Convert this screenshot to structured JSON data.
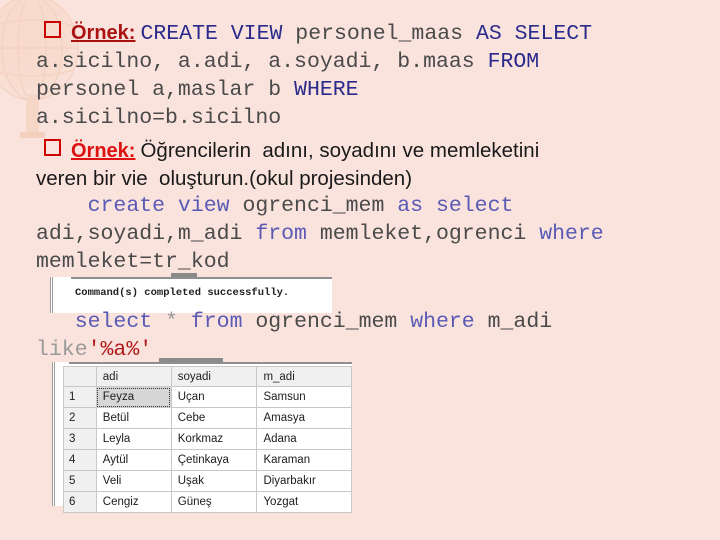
{
  "slide": {
    "background_color": "#fae3dd",
    "watermark": "globe-watermark"
  },
  "block1": {
    "bullet": "square-bullet",
    "label": "Örnek:",
    "label_color": "#aa1111",
    "lines": [
      {
        "parts": [
          {
            "t": "CREATE VIEW ",
            "c": "kw"
          },
          {
            "t": "personel_maas ",
            "c": "ident"
          },
          {
            "t": "AS SELECT",
            "c": "kw"
          }
        ]
      },
      {
        "parts": [
          {
            "t": "a.sicilno, a.adi, a.soyadi, b.maas ",
            "c": "ident"
          },
          {
            "t": "FROM",
            "c": "kw"
          }
        ]
      },
      {
        "parts": [
          {
            "t": "personel a,maslar b ",
            "c": "ident"
          },
          {
            "t": "WHERE",
            "c": "kw"
          }
        ]
      },
      {
        "parts": [
          {
            "t": "a.sicilno=b.sicilno",
            "c": "ident"
          }
        ]
      }
    ],
    "line1_text": "CREATE VIEW personel_maas AS SELECT",
    "line2_text": "a.sicilno, a.adi, a.soyadi, b.maas FROM",
    "line3_text": "personel a,maslar b WHERE",
    "line4_text": "a.sicilno=b.sicilno"
  },
  "block2": {
    "bullet": "square-bullet",
    "label": "Örnek:",
    "label_color": "#dd1111",
    "prompt_line1": "Öğrencilerin  adını, soyadını ve memleketini",
    "prompt_line2": "veren bir vie  oluşturun.(okul projesinden)",
    "sql_line1_a": "create view ",
    "sql_line1_b": "ogrenci_mem ",
    "sql_line1_c": "as select",
    "sql_line2_a": "adi,soyadi,m_adi ",
    "sql_line2_b": "from ",
    "sql_line2_c": "memleket,ogrenci ",
    "sql_line2_d": "where",
    "sql_line3": "memleket=tr_kod"
  },
  "message_box": {
    "text": "Command(s) completed successfully."
  },
  "query2": {
    "a": "select ",
    "b": "* ",
    "c": "from ",
    "d": "ogrenci_mem ",
    "e": "where ",
    "f": "m_adi",
    "g": "like",
    "h": "'%a%'"
  },
  "results_grid": {
    "columns": [
      "adi",
      "soyadi",
      "m_adi"
    ],
    "rows": [
      {
        "n": "1",
        "adi": "Feyza",
        "soyadi": "Uçan",
        "m_adi": "Samsun",
        "selected": true
      },
      {
        "n": "2",
        "adi": "Betül",
        "soyadi": "Cebe",
        "m_adi": "Amasya",
        "selected": false
      },
      {
        "n": "3",
        "adi": "Leyla",
        "soyadi": "Korkmaz",
        "m_adi": "Adana",
        "selected": false
      },
      {
        "n": "4",
        "adi": "Aytül",
        "soyadi": "Çetinkaya",
        "m_adi": "Karaman",
        "selected": false
      },
      {
        "n": "5",
        "adi": "Veli",
        "soyadi": "Uşak",
        "m_adi": "Diyarbakır",
        "selected": false
      },
      {
        "n": "6",
        "adi": "Cengiz",
        "soyadi": "Güneş",
        "m_adi": "Yozgat",
        "selected": false
      }
    ]
  }
}
